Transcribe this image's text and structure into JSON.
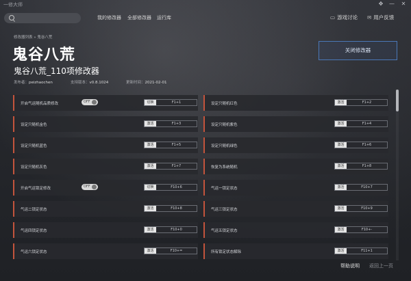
{
  "window": {
    "title": "一修大师",
    "controls": {
      "skin": "✥",
      "minimize": "—",
      "close": "✕"
    }
  },
  "search": {
    "placeholder": ""
  },
  "nav": {
    "items": [
      "我的修改器",
      "全部修改器",
      "运行库"
    ]
  },
  "top_links": [
    {
      "icon": "chat-icon",
      "glyph": "▭",
      "label": "游戏讨论"
    },
    {
      "icon": "feedback-icon",
      "glyph": "✉",
      "label": "用户反馈"
    }
  ],
  "breadcrumb": "修改器列表 » 鬼谷八荒",
  "game": {
    "title": "鬼谷八荒",
    "subtitle": "鬼谷八荒_110项修改器",
    "author_label": "发布者：",
    "author": "peizhaochen",
    "version_label": "支持版本：",
    "version": "v0.8.1024",
    "updated_label": "更新时间：",
    "updated": "2021-02-01"
  },
  "close_button": "关闭修改器",
  "cheats": [
    {
      "label": "开启气运随机品质修改",
      "toggle": "OFF",
      "type": "切换",
      "key": "F1+1"
    },
    {
      "label": "设定只随机红色",
      "type": "激活",
      "key": "F1+2"
    },
    {
      "label": "设定只随机金色",
      "type": "激活",
      "key": "F1+3"
    },
    {
      "label": "设定只随机紫色",
      "type": "激活",
      "key": "F1+4"
    },
    {
      "label": "设定只随机蓝色",
      "type": "激活",
      "key": "F1+5"
    },
    {
      "label": "设定只随机绿色",
      "type": "激活",
      "key": "F1+6"
    },
    {
      "label": "设定只随机灰色",
      "type": "激活",
      "key": "F1+7"
    },
    {
      "label": "恢复为系统随机",
      "type": "激活",
      "key": "F1+8"
    },
    {
      "label": "开启气运锁定修改",
      "toggle": "OFF",
      "type": "切换",
      "key": "F10+6"
    },
    {
      "label": "气运一锁定状态",
      "type": "激活",
      "key": "F10+7"
    },
    {
      "label": "气运二锁定状态",
      "type": "激活",
      "key": "F10+8"
    },
    {
      "label": "气运三锁定状态",
      "type": "激活",
      "key": "F10+9"
    },
    {
      "label": "气运四锁定状态",
      "type": "激活",
      "key": "F10+0"
    },
    {
      "label": "气运五锁定状态",
      "type": "激活",
      "key": "F10+-"
    },
    {
      "label": "气运六锁定状态",
      "type": "激活",
      "key": "F10+="
    },
    {
      "label": "所有锁定状态解除",
      "type": "激活",
      "key": "F11+1"
    }
  ],
  "footer": {
    "help": "帮助说明",
    "back": "返回上一页"
  },
  "scroll": {
    "position_fraction": 0.0
  }
}
